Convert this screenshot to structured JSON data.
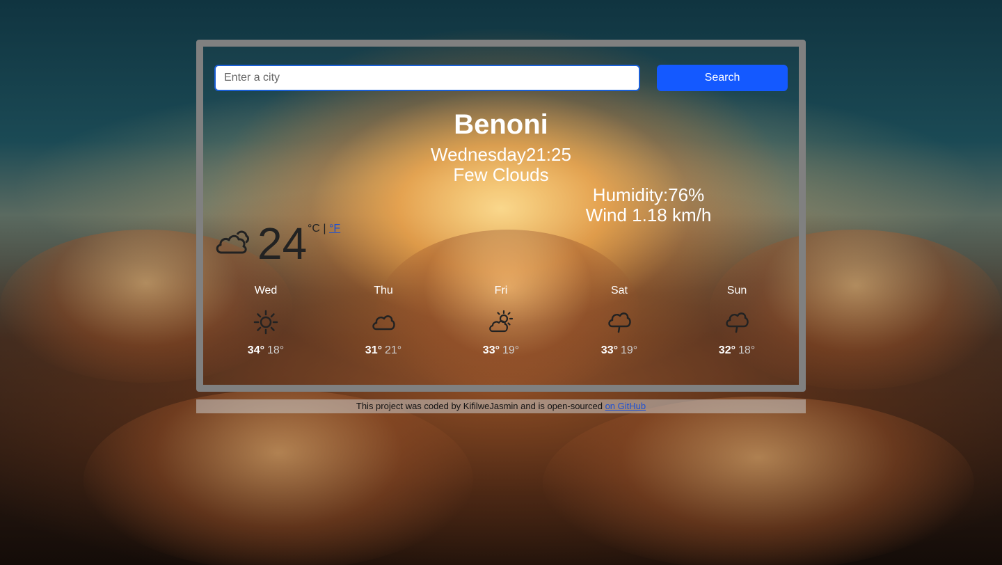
{
  "search": {
    "placeholder": "Enter a city",
    "button_label": "Search"
  },
  "current": {
    "city": "Benoni",
    "day": "Wednesday",
    "time": "21:25",
    "description": "Few Clouds",
    "humidity_label": "Humidity:",
    "humidity": "76%",
    "wind_label": "Wind",
    "wind": "1.18 km/h",
    "temperature": "24",
    "unit_c": "°C",
    "unit_sep": " | ",
    "unit_f": "°F",
    "icon": "cloud-icon"
  },
  "forecast": [
    {
      "day": "Wed",
      "max": "34°",
      "min": "18°",
      "icon": "sun-icon"
    },
    {
      "day": "Thu",
      "max": "31°",
      "min": "21°",
      "icon": "cloud-icon"
    },
    {
      "day": "Fri",
      "max": "33°",
      "min": "19°",
      "icon": "partly-cloudy-icon"
    },
    {
      "day": "Sat",
      "max": "33°",
      "min": "19°",
      "icon": "rain-cloud-icon"
    },
    {
      "day": "Sun",
      "max": "32°",
      "min": "18°",
      "icon": "rain-cloud-icon"
    }
  ],
  "footer": {
    "text": "This project was coded by KifilweJasmin and is open-sourced ",
    "link": "on GitHub"
  },
  "colors": {
    "accent": "#1459ff",
    "frame": "#808080"
  }
}
